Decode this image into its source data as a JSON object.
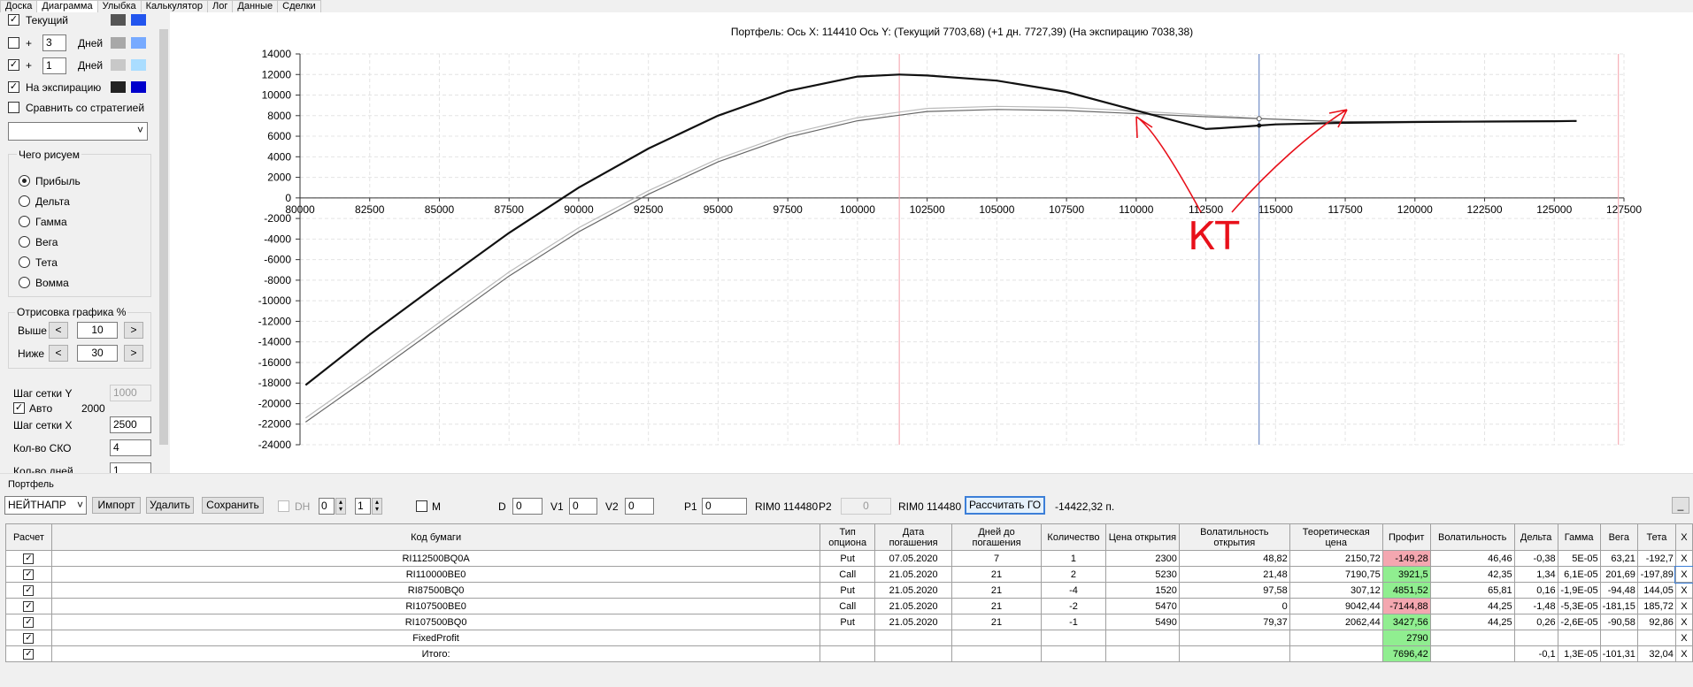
{
  "tabs": [
    "Доска",
    "Диаграмма",
    "Улыбка",
    "Калькулятор",
    "Лог",
    "Данные",
    "Сделки"
  ],
  "active_tab": 1,
  "left": {
    "current_label": "Текущий",
    "plus": "+",
    "days_label": "Дней",
    "days1": "3",
    "days2": "1",
    "expiry_label": "На экспирацию",
    "compare_label": "Сравнить со стратегией",
    "draw_group": "Чего рисуем",
    "radios": [
      "Прибыль",
      "Дельта",
      "Гамма",
      "Вега",
      "Тета",
      "Вомма"
    ],
    "render_group": "Отрисовка графика %",
    "above_label": "Выше",
    "above_val": "10",
    "below_label": "Ниже",
    "below_val": "30",
    "dec": "<",
    "inc": ">",
    "grid_y_label": "Шаг сетки Y",
    "grid_y_val": "1000",
    "auto_label": "Авто",
    "auto_val": "2000",
    "grid_x_label": "Шаг сетки X",
    "grid_x_val": "2500",
    "sko_label": "Кол-во СКО",
    "sko_val": "4",
    "days_cnt_label": "Кол-во дней",
    "days_cnt_val": "1",
    "check_mark": "✓",
    "chevron": "˅",
    "colors": {
      "current_a": "#555555",
      "current_b": "#2255ee",
      "p3_a": "#a8a8a8",
      "p3_b": "#77aaff",
      "p1_a": "#c8c8c8",
      "p1_b": "#aaddff",
      "exp_a": "#222222",
      "exp_b": "#0000cc"
    }
  },
  "chart_data": {
    "type": "line",
    "title": "Портфель:  Ось X:  114410 Ось Y:   (Текущий 7703,68)   (+1 дн. 7727,39)   (На экспирацию 7038,38)",
    "xlim": [
      80000,
      127500
    ],
    "ylim": [
      -24000,
      14000
    ],
    "x_ticks": [
      80000,
      82500,
      85000,
      87500,
      90000,
      92500,
      95000,
      97500,
      100000,
      102500,
      105000,
      107500,
      110000,
      112500,
      115000,
      117500,
      120000,
      122500,
      125000,
      127500
    ],
    "y_ticks": [
      14000,
      12000,
      10000,
      8000,
      6000,
      4000,
      2000,
      0,
      -2000,
      -4000,
      -6000,
      -8000,
      -10000,
      -12000,
      -14000,
      -16000,
      -18000,
      -20000,
      -22000,
      -24000
    ],
    "cursor_x": 114410,
    "red_lines_x": [
      101500,
      127300
    ],
    "series": [
      {
        "color": "#111111",
        "width": 2.2,
        "x": [
          80200,
          82500,
          85000,
          87500,
          90000,
          92500,
          95000,
          97500,
          100000,
          101500,
          102500,
          105000,
          107500,
          110000,
          112500,
          113000,
          114400,
          115000,
          117500,
          120000,
          122500,
          125000,
          125800
        ],
        "y": [
          -18200,
          -13300,
          -8300,
          -3400,
          1000,
          4800,
          8000,
          10400,
          11800,
          12000,
          11900,
          11400,
          10300,
          8500,
          6700,
          6780,
          7038,
          7150,
          7300,
          7380,
          7420,
          7460,
          7480
        ]
      },
      {
        "color": "#666666",
        "width": 1.2,
        "x": [
          80200,
          82500,
          85000,
          87500,
          90000,
          92500,
          95000,
          97500,
          100000,
          102500,
          105000,
          107500,
          110000,
          112500,
          114400,
          117500,
          120000,
          122500,
          125000,
          125800
        ],
        "y": [
          -21800,
          -17400,
          -12500,
          -7600,
          -3300,
          360,
          3500,
          5900,
          7500,
          8400,
          8600,
          8500,
          8200,
          7900,
          7704,
          7400,
          7420,
          7450,
          7480,
          7490
        ]
      },
      {
        "color": "#bbbbbb",
        "width": 1.2,
        "x": [
          80200,
          82500,
          85000,
          87500,
          90000,
          92500,
          95000,
          97500,
          100000,
          102500,
          105000,
          107500,
          110000,
          112500,
          114400,
          117500,
          120000,
          122500,
          125000,
          125800
        ],
        "y": [
          -21400,
          -17000,
          -12100,
          -7200,
          -2900,
          700,
          3800,
          6200,
          7800,
          8700,
          8900,
          8800,
          8450,
          8050,
          7727,
          7420,
          7430,
          7460,
          7480,
          7490
        ]
      }
    ]
  },
  "annotation": {
    "text": "КТ"
  },
  "bottom": {
    "group_label": "Портфель",
    "strategy": "НЕЙТНАПР",
    "import": "Импорт",
    "delete": "Удалить",
    "save": "Сохранить",
    "dh": "DH",
    "dh_a": "0",
    "dh_b": "1",
    "m": "M",
    "d": "D",
    "d_val": "0",
    "v1": "V1",
    "v1_val": "0",
    "v2": "V2",
    "v2_val": "0",
    "p1": "P1",
    "p1_val": "0",
    "rim1": "RIM0 114480",
    "p2": "P2",
    "p2_val": "0",
    "rim2": "RIM0 114480",
    "calc": "Рассчитать ГО",
    "go_val": "-14422,32 п.",
    "min_btn": "_",
    "spin_up": "▴",
    "spin_down": "▾",
    "x_label": "X"
  },
  "table": {
    "headers": [
      "Расчет",
      "Код бумаги",
      "Тип опциона",
      "Дата погашения",
      "Дней до погашения",
      "Количество",
      "Цена открытия",
      "Волатильность открытия",
      "Теоретическая цена",
      "Профит",
      "Волатильность",
      "Дельта",
      "Гамма",
      "Вега",
      "Тета",
      "X"
    ],
    "rows": [
      [
        "RI112500BQ0A",
        "Put",
        "07.05.2020",
        "7",
        "1",
        "2300",
        "48,82",
        "2150,72",
        "-149,28",
        "46,46",
        "-0,38",
        "5E-05",
        "63,21",
        "-192,7"
      ],
      [
        "RI110000BE0",
        "Call",
        "21.05.2020",
        "21",
        "2",
        "5230",
        "21,48",
        "7190,75",
        "3921,5",
        "42,35",
        "1,34",
        "6,1E-05",
        "201,69",
        "-197,89"
      ],
      [
        "RI87500BQ0",
        "Put",
        "21.05.2020",
        "21",
        "-4",
        "1520",
        "97,58",
        "307,12",
        "4851,52",
        "65,81",
        "0,16",
        "-1,9E-05",
        "-94,48",
        "144,05"
      ],
      [
        "RI107500BE0",
        "Call",
        "21.05.2020",
        "21",
        "-2",
        "5470",
        "0",
        "9042,44",
        "-7144,88",
        "44,25",
        "-1,48",
        "-5,3E-05",
        "-181,15",
        "185,72"
      ],
      [
        "RI107500BQ0",
        "Put",
        "21.05.2020",
        "21",
        "-1",
        "5490",
        "79,37",
        "2062,44",
        "3427,56",
        "44,25",
        "0,26",
        "-2,6E-05",
        "-90,58",
        "92,86"
      ],
      [
        "FixedProfit",
        "",
        "",
        "",
        "",
        "",
        "",
        "",
        "2790",
        "",
        "",
        "",
        "",
        "",
        ""
      ],
      [
        "Итого:",
        "",
        "",
        "",
        "",
        "",
        "",
        "",
        "7696,42",
        "",
        "-0,1",
        "1,3E-05",
        "-101,31",
        "32,04"
      ]
    ],
    "profit_signs": [
      "neg",
      "pos",
      "pos",
      "neg",
      "pos",
      "pos",
      "pos"
    ]
  }
}
